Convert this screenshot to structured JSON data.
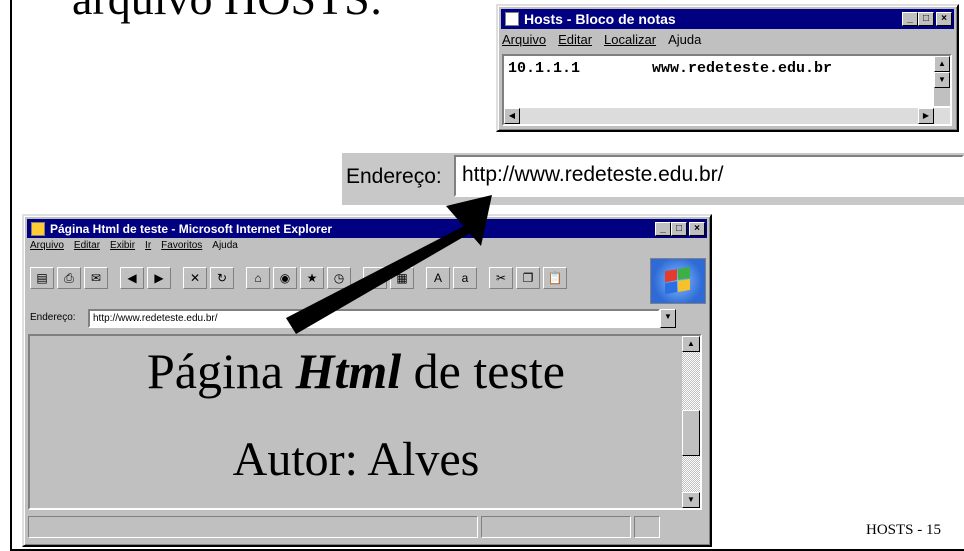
{
  "slide": {
    "title_fragment": "arquivo HOSTS:",
    "footer": "HOSTS - 15"
  },
  "notepad": {
    "title": "Hosts - Bloco de notas",
    "menu": [
      "Arquivo",
      "Editar",
      "Localizar",
      "Ajuda"
    ],
    "hosts_line": {
      "ip": "10.1.1.1",
      "host": "www.redeteste.edu.br"
    }
  },
  "address_zoom": {
    "label": "Endereço:",
    "url": "http://www.redeteste.edu.br/"
  },
  "browser": {
    "title": "Página Html de teste - Microsoft Internet Explorer",
    "menu": [
      "Arquivo",
      "Editar",
      "Exibir",
      "Ir",
      "Favoritos",
      "Ajuda"
    ],
    "address_label": "Endereço:",
    "address_url": "http://www.redeteste.edu.br/",
    "page": {
      "heading_prefix": "Página ",
      "heading_emphasis": "Html",
      "heading_suffix": " de teste",
      "author": "Autor: Alves"
    }
  },
  "icons": {
    "arrow": "arrow-icon",
    "windows_logo": "windows-logo-icon"
  }
}
